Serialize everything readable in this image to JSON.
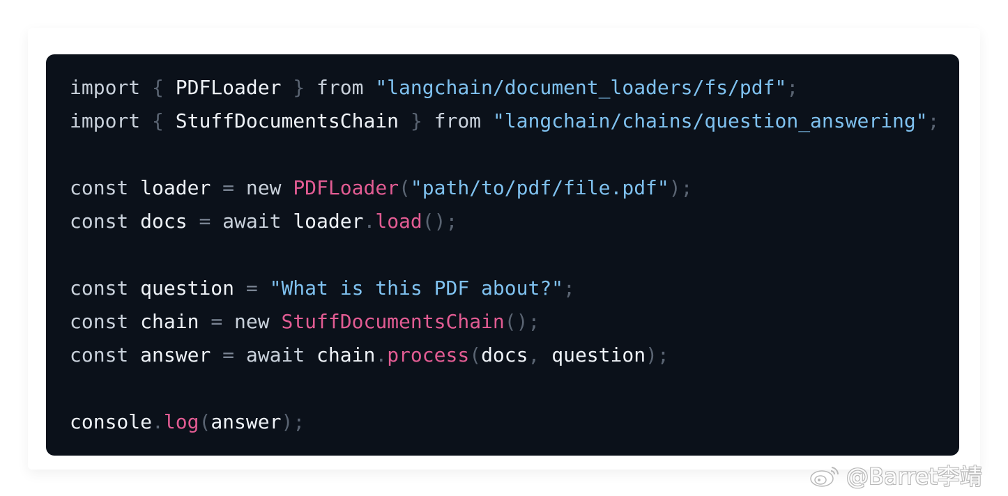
{
  "code": {
    "lines": [
      [
        {
          "t": "import",
          "c": "kw"
        },
        {
          "t": " ",
          "c": "sp"
        },
        {
          "t": "{",
          "c": "punc"
        },
        {
          "t": " ",
          "c": "sp"
        },
        {
          "t": "PDFLoader",
          "c": "id"
        },
        {
          "t": " ",
          "c": "sp"
        },
        {
          "t": "}",
          "c": "punc"
        },
        {
          "t": " ",
          "c": "sp"
        },
        {
          "t": "from",
          "c": "kw"
        },
        {
          "t": " ",
          "c": "sp"
        },
        {
          "t": "\"langchain/document_loaders/fs/pdf\"",
          "c": "str"
        },
        {
          "t": ";",
          "c": "punc"
        }
      ],
      [
        {
          "t": "import",
          "c": "kw"
        },
        {
          "t": " ",
          "c": "sp"
        },
        {
          "t": "{",
          "c": "punc"
        },
        {
          "t": " ",
          "c": "sp"
        },
        {
          "t": "StuffDocumentsChain",
          "c": "id"
        },
        {
          "t": " ",
          "c": "sp"
        },
        {
          "t": "}",
          "c": "punc"
        },
        {
          "t": " ",
          "c": "sp"
        },
        {
          "t": "from",
          "c": "kw"
        },
        {
          "t": " ",
          "c": "sp"
        },
        {
          "t": "\"langchain/chains/question_answering\"",
          "c": "str"
        },
        {
          "t": ";",
          "c": "punc"
        }
      ],
      [],
      [
        {
          "t": "const",
          "c": "kw"
        },
        {
          "t": " ",
          "c": "sp"
        },
        {
          "t": "loader",
          "c": "id"
        },
        {
          "t": " ",
          "c": "sp"
        },
        {
          "t": "=",
          "c": "op"
        },
        {
          "t": " ",
          "c": "sp"
        },
        {
          "t": "new",
          "c": "kw"
        },
        {
          "t": " ",
          "c": "sp"
        },
        {
          "t": "PDFLoader",
          "c": "fn"
        },
        {
          "t": "(",
          "c": "punc"
        },
        {
          "t": "\"path/to/pdf/file.pdf\"",
          "c": "str"
        },
        {
          "t": ");",
          "c": "punc"
        }
      ],
      [
        {
          "t": "const",
          "c": "kw"
        },
        {
          "t": " ",
          "c": "sp"
        },
        {
          "t": "docs",
          "c": "id"
        },
        {
          "t": " ",
          "c": "sp"
        },
        {
          "t": "=",
          "c": "op"
        },
        {
          "t": " ",
          "c": "sp"
        },
        {
          "t": "await",
          "c": "kw"
        },
        {
          "t": " ",
          "c": "sp"
        },
        {
          "t": "loader",
          "c": "id"
        },
        {
          "t": ".",
          "c": "punc"
        },
        {
          "t": "load",
          "c": "fn"
        },
        {
          "t": "();",
          "c": "punc"
        }
      ],
      [],
      [
        {
          "t": "const",
          "c": "kw"
        },
        {
          "t": " ",
          "c": "sp"
        },
        {
          "t": "question",
          "c": "id"
        },
        {
          "t": " ",
          "c": "sp"
        },
        {
          "t": "=",
          "c": "op"
        },
        {
          "t": " ",
          "c": "sp"
        },
        {
          "t": "\"What is this PDF about?\"",
          "c": "str"
        },
        {
          "t": ";",
          "c": "punc"
        }
      ],
      [
        {
          "t": "const",
          "c": "kw"
        },
        {
          "t": " ",
          "c": "sp"
        },
        {
          "t": "chain",
          "c": "id"
        },
        {
          "t": " ",
          "c": "sp"
        },
        {
          "t": "=",
          "c": "op"
        },
        {
          "t": " ",
          "c": "sp"
        },
        {
          "t": "new",
          "c": "kw"
        },
        {
          "t": " ",
          "c": "sp"
        },
        {
          "t": "StuffDocumentsChain",
          "c": "fn"
        },
        {
          "t": "();",
          "c": "punc"
        }
      ],
      [
        {
          "t": "const",
          "c": "kw"
        },
        {
          "t": " ",
          "c": "sp"
        },
        {
          "t": "answer",
          "c": "id"
        },
        {
          "t": " ",
          "c": "sp"
        },
        {
          "t": "=",
          "c": "op"
        },
        {
          "t": " ",
          "c": "sp"
        },
        {
          "t": "await",
          "c": "kw"
        },
        {
          "t": " ",
          "c": "sp"
        },
        {
          "t": "chain",
          "c": "id"
        },
        {
          "t": ".",
          "c": "punc"
        },
        {
          "t": "process",
          "c": "fn"
        },
        {
          "t": "(",
          "c": "punc"
        },
        {
          "t": "docs",
          "c": "id"
        },
        {
          "t": ",",
          "c": "punc"
        },
        {
          "t": " ",
          "c": "sp"
        },
        {
          "t": "question",
          "c": "id"
        },
        {
          "t": ");",
          "c": "punc"
        }
      ],
      [],
      [
        {
          "t": "console",
          "c": "id"
        },
        {
          "t": ".",
          "c": "punc"
        },
        {
          "t": "log",
          "c": "fn"
        },
        {
          "t": "(",
          "c": "punc"
        },
        {
          "t": "answer",
          "c": "id"
        },
        {
          "t": ");",
          "c": "punc"
        }
      ]
    ]
  },
  "colors": {
    "background": "#0b111a",
    "keyword": "#c9d1db",
    "identifier": "#eef2f7",
    "punctuation": "#5a6472",
    "string": "#7fc1ef",
    "function": "#e25c93"
  },
  "watermark": {
    "icon": "weibo-icon",
    "text": "@Barret李靖"
  }
}
